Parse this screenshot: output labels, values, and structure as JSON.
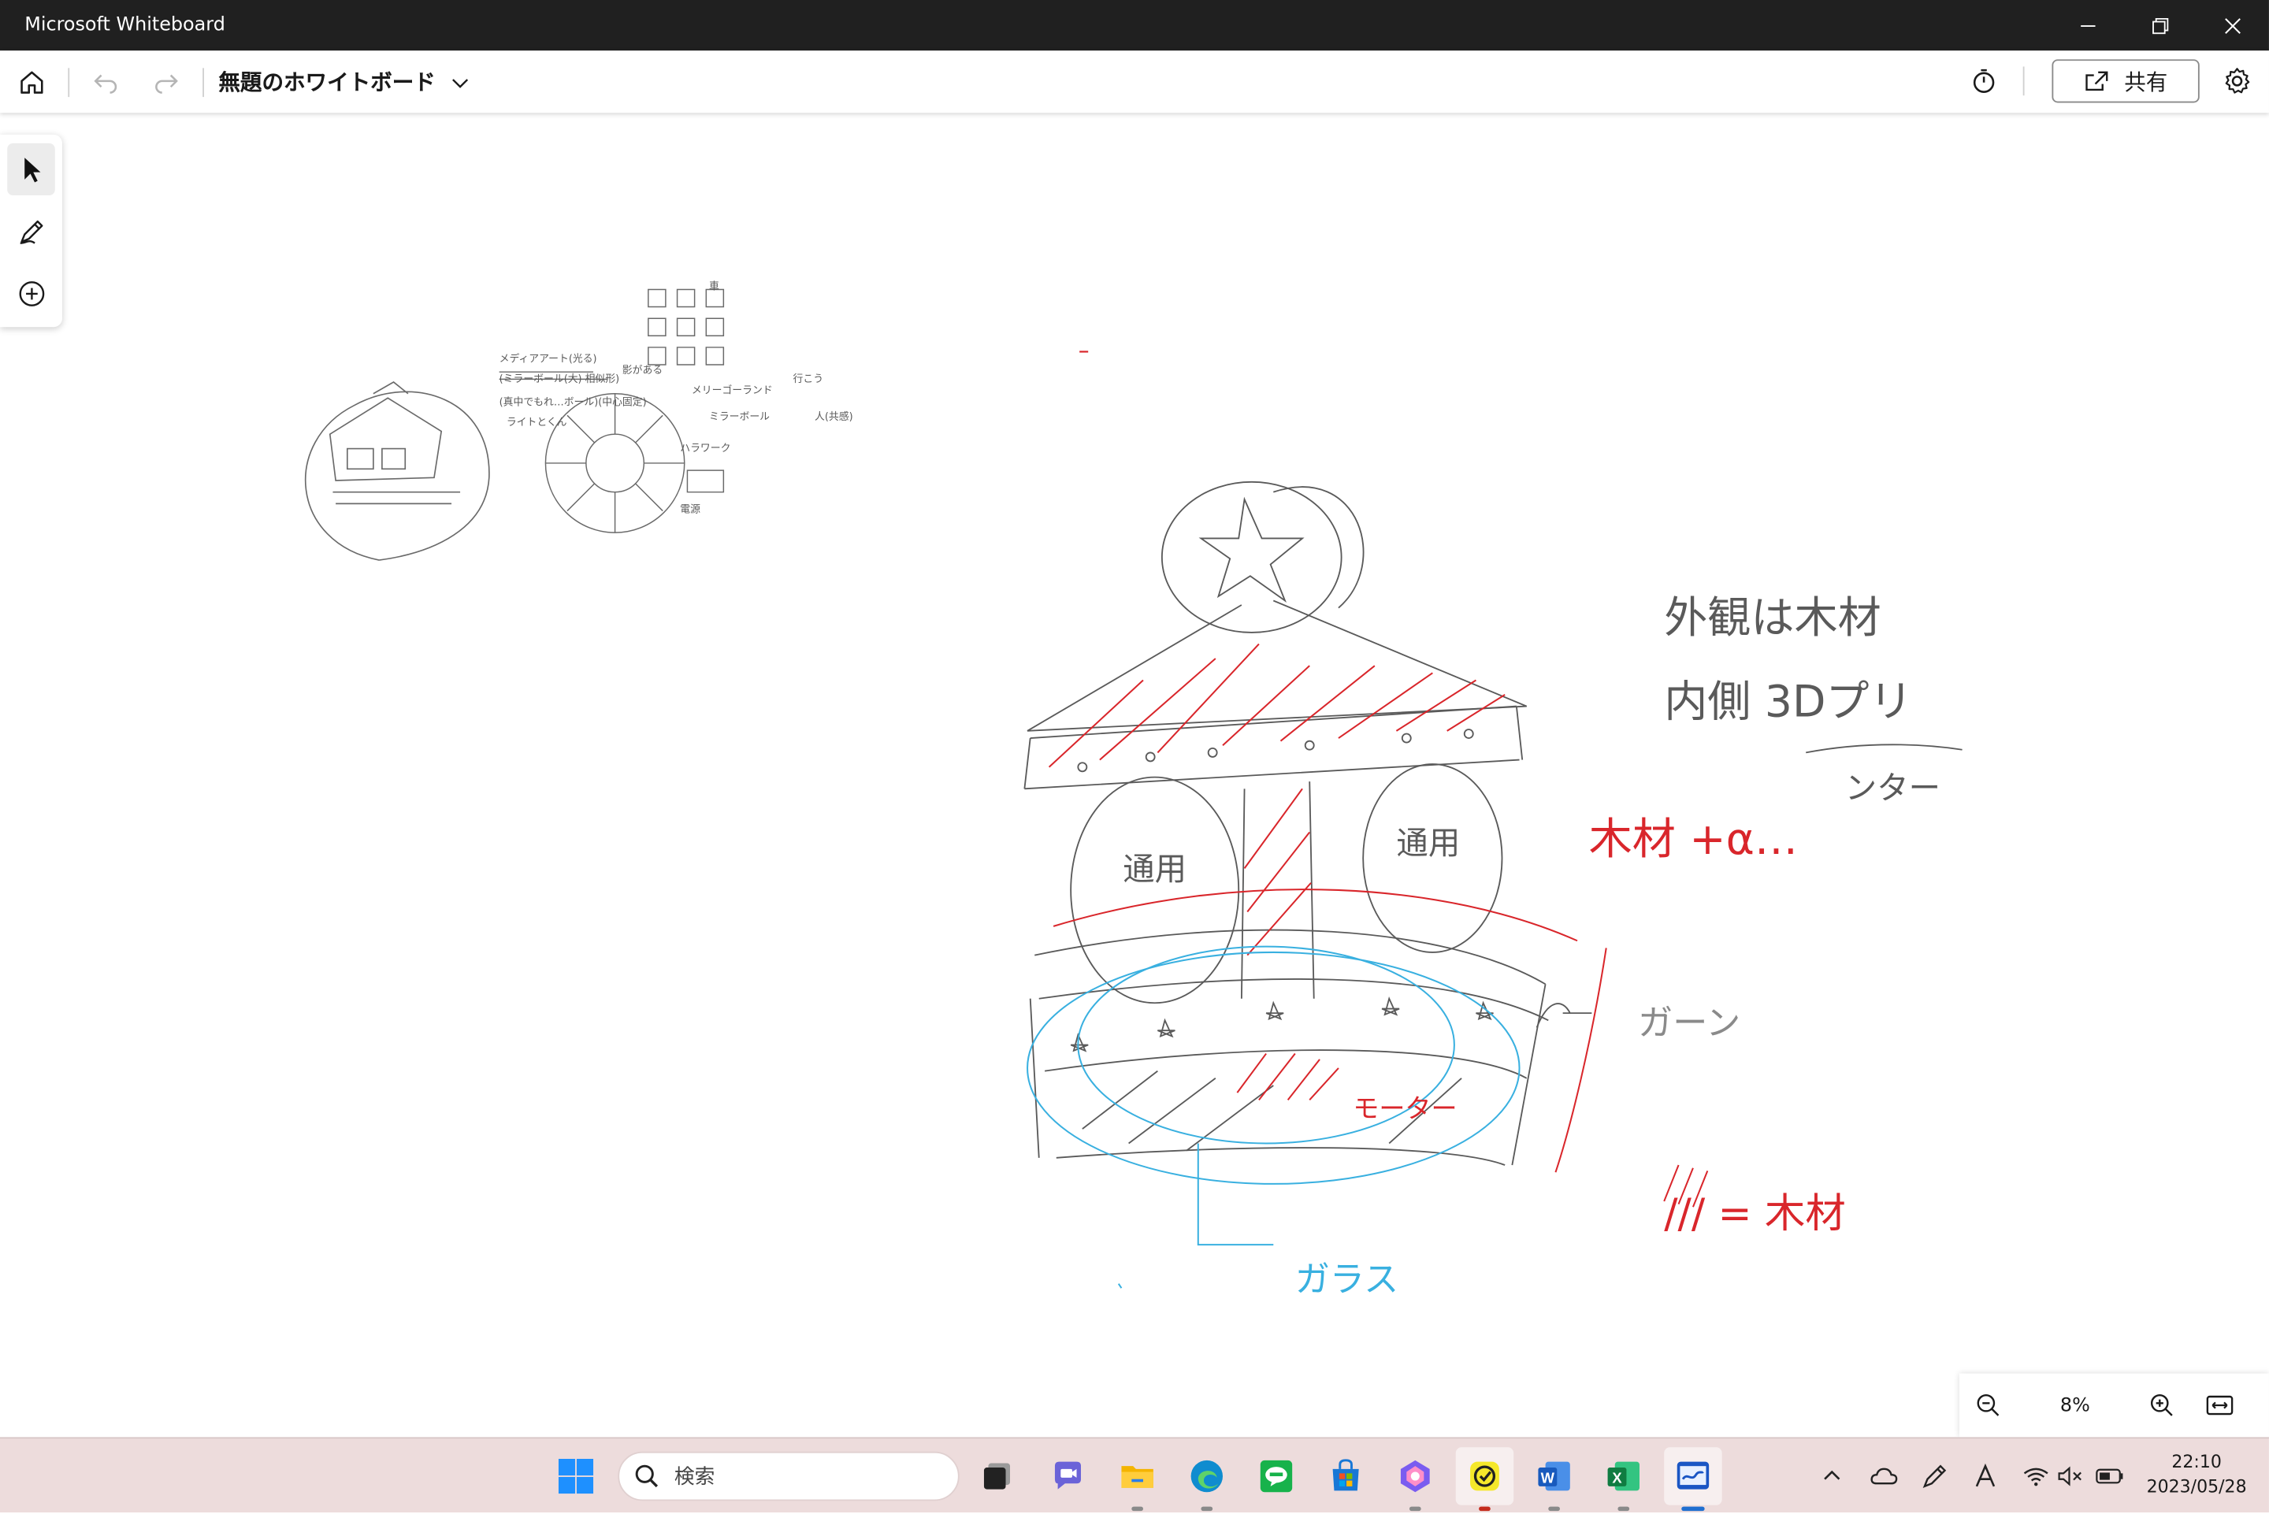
{
  "window": {
    "title": "Microsoft Whiteboard"
  },
  "appbar": {
    "board_title": "無題のホワイトボード",
    "share_label": "共有"
  },
  "toolbar": {
    "tools": [
      "select-tool",
      "pen-tool",
      "add-tool"
    ]
  },
  "canvas": {
    "annotations": {
      "exterior_note_line1": "外観は木材",
      "exterior_note_line2": "内側 3Dプリ",
      "exterior_note_line3": "ンター",
      "wood_plus": "木材 +α…",
      "gear": "ガーン",
      "motor": "モーター",
      "wood_legend": "/// = 木材",
      "glass": "ガラス",
      "plate_left": "通用",
      "plate_right": "通用"
    },
    "small_notes": {
      "media_art": "メディアアート(光る)",
      "mirror_ball": "(ミラーボール(大)  相似形)",
      "rotate": "(真中でもれ…ボール)(中心固定)",
      "light": "ライトとくん",
      "shadow": "影がある",
      "merry_go_round": "メリーゴーランド",
      "mirror_ball2": "ミラーボール",
      "kyoun": "ハラワーク",
      "power": "電源",
      "person": "人(共感)",
      "car": "車",
      "lets_go": "行こう"
    },
    "colors": {
      "pencil": "#5a5a5a",
      "red": "#d9262b",
      "blue": "#39b0e0"
    }
  },
  "zoom": {
    "value": "8%"
  },
  "taskbar": {
    "search_placeholder": "検索",
    "apps": [
      "windows-start",
      "task-view",
      "teams-chat",
      "file-explorer",
      "edge",
      "line",
      "microsoft-store",
      "copilot",
      "sticky-todo",
      "word",
      "excel",
      "whiteboard"
    ],
    "tray": {
      "time": "22:10",
      "date": "2023/05/28"
    }
  }
}
